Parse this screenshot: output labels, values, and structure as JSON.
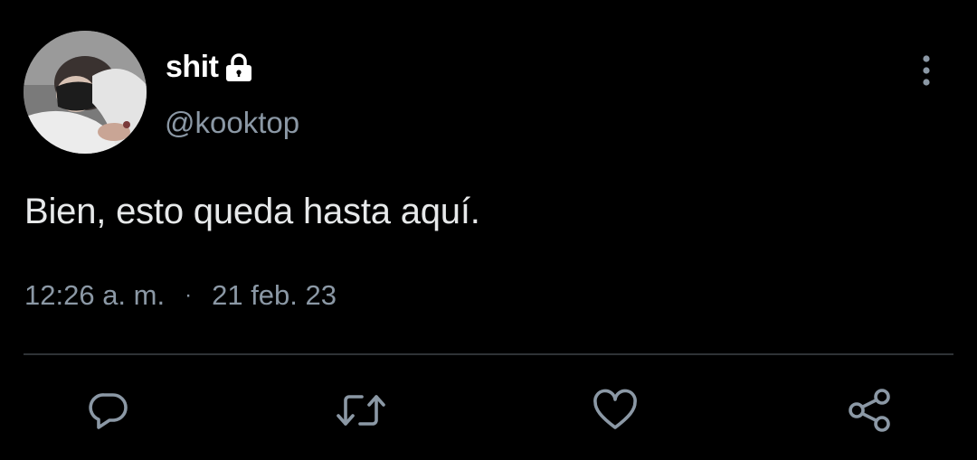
{
  "author": {
    "display_name": "shit",
    "handle": "@kooktop",
    "protected_icon": "lock-icon",
    "avatar": "profile-photo"
  },
  "tweet": {
    "text": "Bien, esto queda hasta aquí.",
    "time": "12:26 a. m.",
    "separator": "·",
    "date": "21 feb. 23"
  },
  "actions": {
    "more": "more-vertical-icon",
    "reply": "reply-icon",
    "retweet": "retweet-icon",
    "like": "heart-icon",
    "share": "share-icon"
  },
  "colors": {
    "background": "#000000",
    "primary_text": "#e7e9ea",
    "secondary_text": "#8b98a5",
    "divider": "#2f3336"
  }
}
